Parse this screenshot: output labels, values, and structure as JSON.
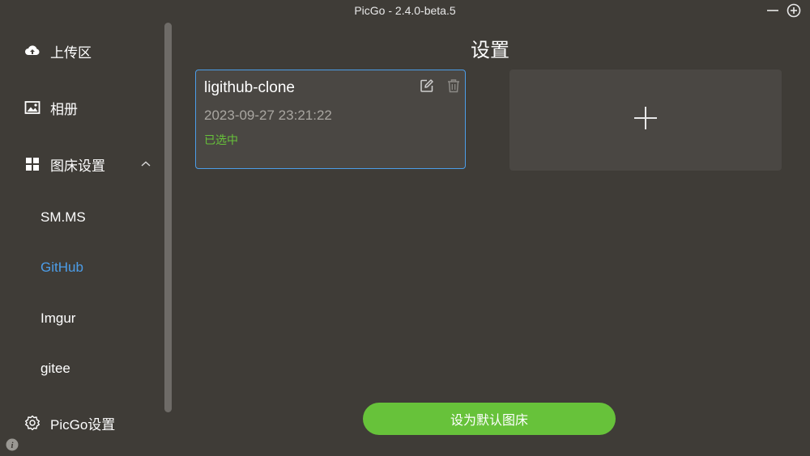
{
  "window": {
    "title": "PicGo - 2.4.0-beta.5",
    "controls": [
      "minimize-icon",
      "maximize-icon"
    ]
  },
  "sidebar": {
    "upload": {
      "label": "上传区",
      "icon": "cloud-upload-icon"
    },
    "gallery": {
      "label": "相册",
      "icon": "image-icon"
    },
    "picbed": {
      "label": "图床设置",
      "icon": "grid-icon",
      "expanded": true
    },
    "picbed_items": [
      {
        "label": "SM.MS",
        "active": false
      },
      {
        "label": "GitHub",
        "active": true
      },
      {
        "label": "Imgur",
        "active": false
      },
      {
        "label": "gitee",
        "active": false
      }
    ],
    "settings": {
      "label": "PicGo设置",
      "icon": "gear-icon"
    }
  },
  "main": {
    "title": "设置",
    "config_card": {
      "name": "ligithub-clone",
      "date": "2023-09-27 23:21:22",
      "status": "已选中"
    },
    "default_button": "设为默认图床"
  },
  "colors": {
    "accent": "#4c9de8",
    "success": "#67c23a",
    "background": "#3f3c37",
    "card": "#4a4743"
  }
}
